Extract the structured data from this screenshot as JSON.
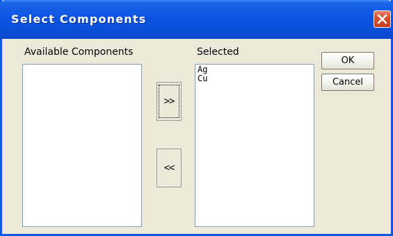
{
  "window": {
    "title": "Select Components"
  },
  "available": {
    "label": "Available Components",
    "items": []
  },
  "selected": {
    "label": "Selected",
    "items": [
      "Ag",
      "Cu"
    ]
  },
  "movers": {
    "add_label": ">>",
    "remove_label": "<<"
  },
  "buttons": {
    "ok_label": "OK",
    "cancel_label": "Cancel"
  },
  "icons": {
    "close": "close-icon"
  },
  "colors": {
    "titlebar": "#0b55e3",
    "close": "#d4502e",
    "dialog_bg": "#ece9d8"
  }
}
